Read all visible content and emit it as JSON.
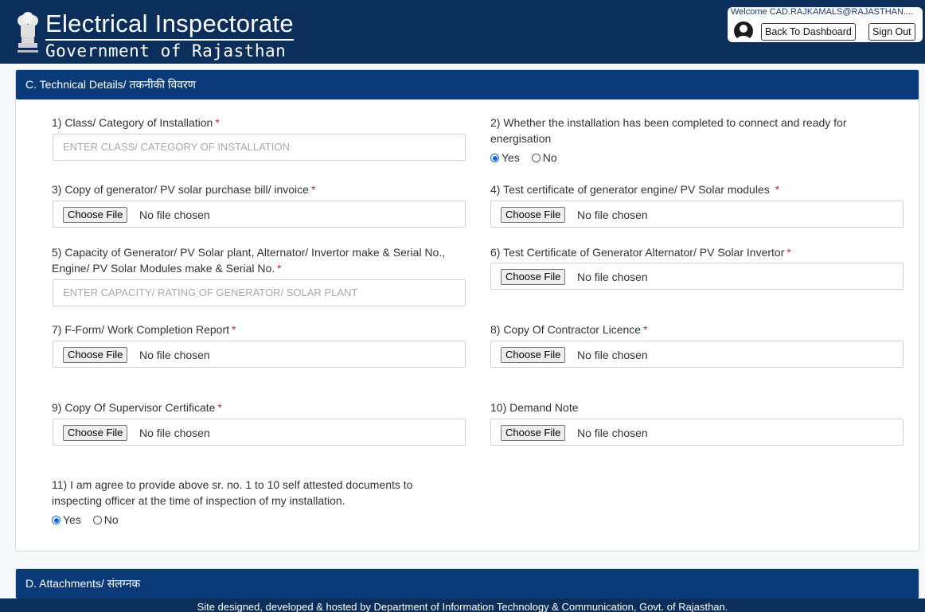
{
  "header": {
    "title": "Electrical Inspectorate",
    "subtitle": "Government of Rajasthan",
    "welcome": "Welcome CAD.RAJKAMALS@RAJASTHAN....",
    "back_button": "Back To Dashboard",
    "signout_button": "Sign Out"
  },
  "section_c": {
    "title": "C. Technical Details/ तकनीकी विवरण",
    "fields": {
      "f1": {
        "label": "1) Class/ Category of Installation",
        "placeholder": "ENTER CLASS/ CATEGORY OF INSTALLATION"
      },
      "f2": {
        "label_line1": "2) Whether the installation has been completed to connect and ready for",
        "label_line2": "energisation",
        "opt_yes": "Yes",
        "opt_no": "No",
        "selected": "Yes"
      },
      "f3": {
        "label": "3) Copy of generator/ PV solar purchase bill/ invoice"
      },
      "f4": {
        "label": "4) Test certificate of generator engine/ PV Solar modules"
      },
      "f5": {
        "label_line1": "5) Capacity of Generator/ PV Solar plant, Alternator/ Invertor make & Serial No.,",
        "label_line2": "Engine/ PV Solar Modules make & Serial No.",
        "placeholder": "ENTER CAPACITY/ RATING OF GENERATOR/ SOLAR PLANT"
      },
      "f6": {
        "label": "6) Test Certificate of Generator Alternator/ PV Solar Invertor"
      },
      "f7": {
        "label": "7) F-Form/ Work Completion Report"
      },
      "f8": {
        "label": "8) Copy Of Contractor Licence"
      },
      "f9": {
        "label": "9) Copy Of Supervisor Certificate"
      },
      "f10": {
        "label": "10) Demand Note"
      },
      "f11": {
        "label_line1": "11) I am agree to provide above sr. no. 1 to 10 self attested documents to",
        "label_line2": "inspecting officer at the time of inspection of my installation.",
        "opt_yes": "Yes",
        "opt_no": "No",
        "selected": "Yes"
      }
    },
    "required_mark": "*",
    "file_button": "Choose File",
    "file_status": "No file chosen"
  },
  "section_d": {
    "title": "D. Attachments/ संलग्नक"
  },
  "footer": {
    "text": "Site designed, developed & hosted by Department of Information Technology & Communication, Govt. of Rajasthan."
  },
  "colors": {
    "header_bg": "#0b2f5a",
    "section_header_bg": "#0b3a78",
    "required": "#d9232d",
    "radio_accent": "#0a66e0"
  }
}
